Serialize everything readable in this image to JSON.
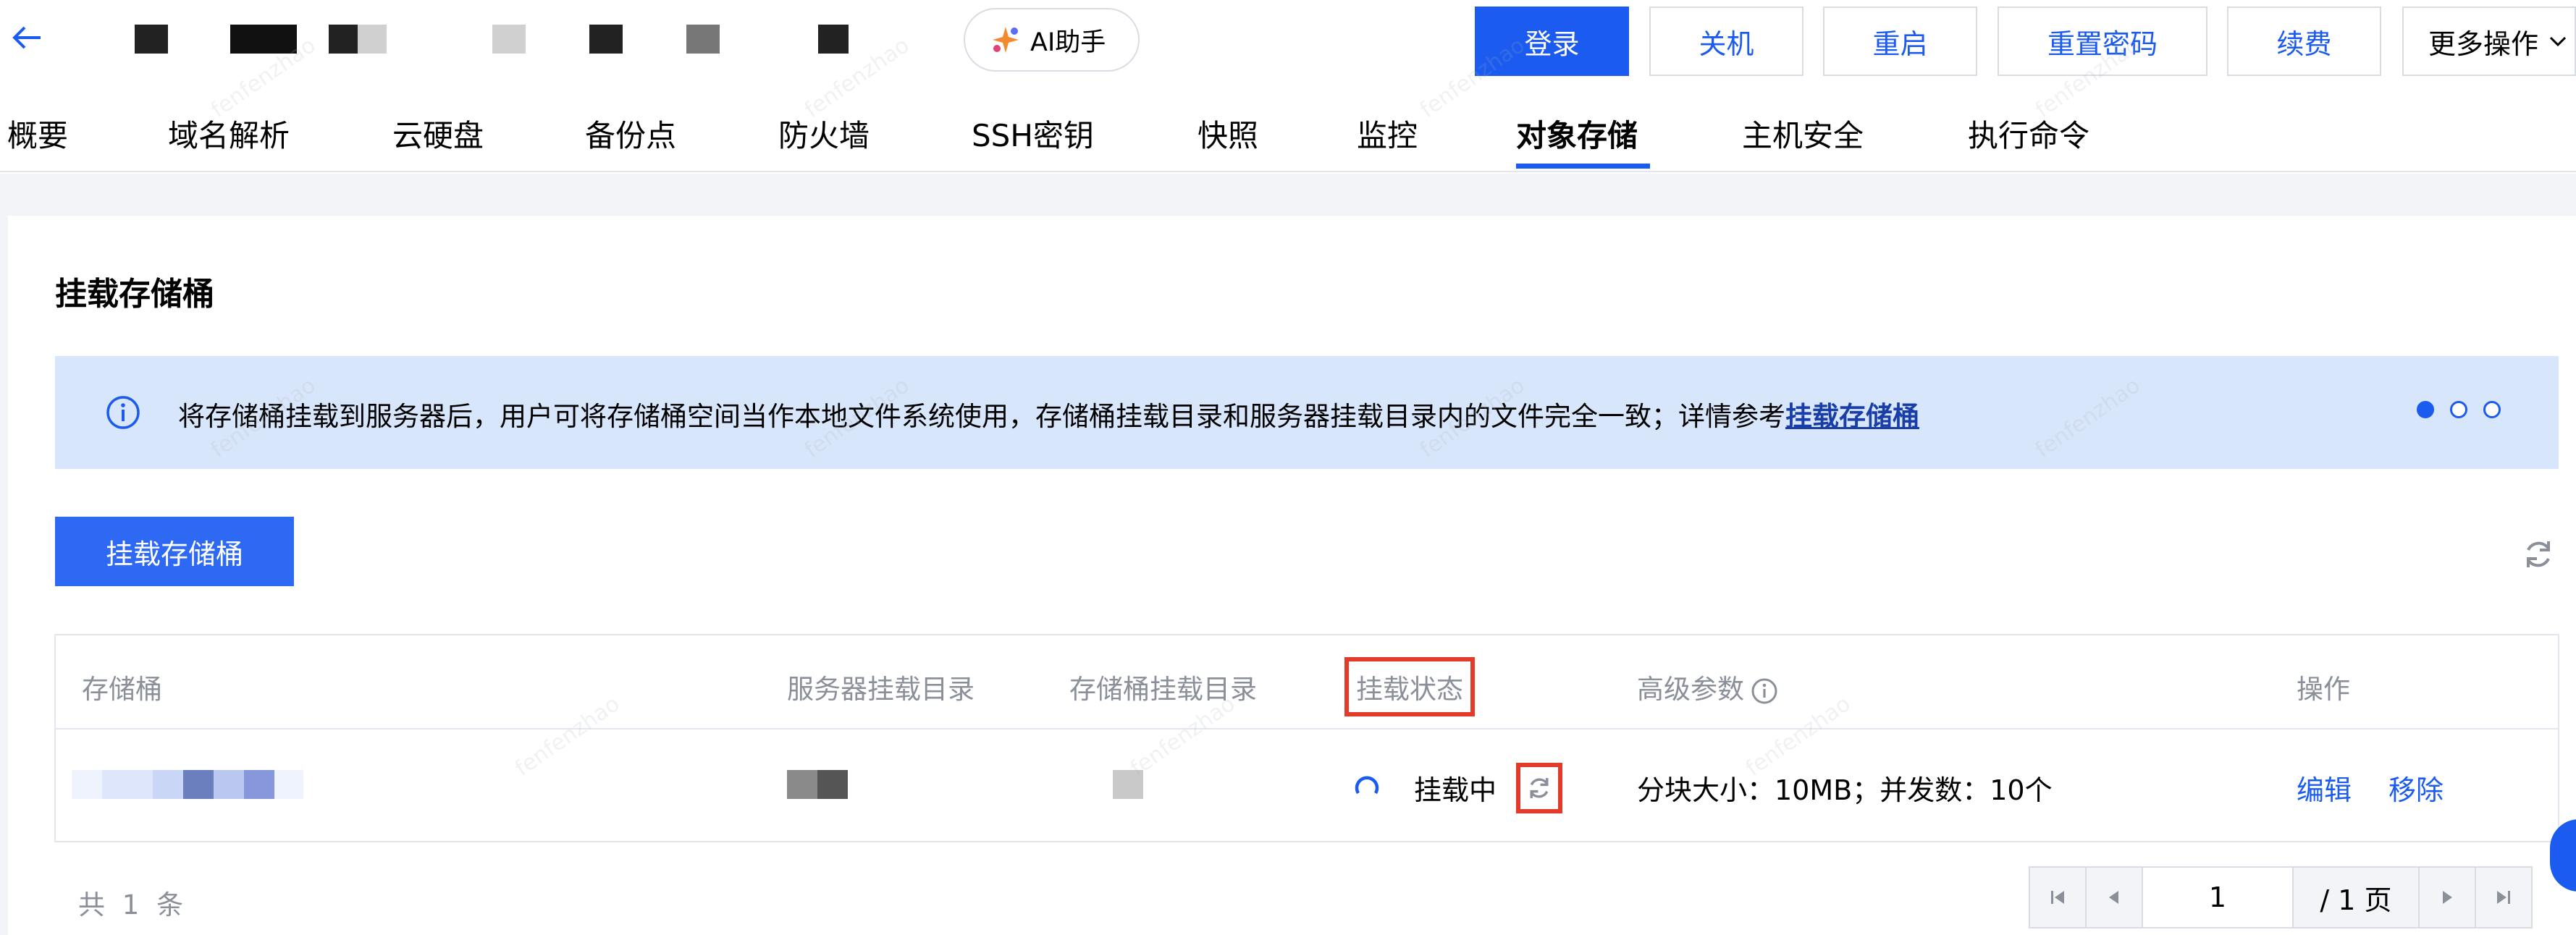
{
  "toolbar": {
    "ai_label": "AI助手",
    "login": "登录",
    "shutdown": "关机",
    "restart": "重启",
    "reset_password": "重置密码",
    "renew": "续费",
    "more": "更多操作"
  },
  "tabs": [
    "概要",
    "域名解析",
    "云硬盘",
    "备份点",
    "防火墙",
    "SSH密钥",
    "快照",
    "监控",
    "对象存储",
    "主机安全",
    "执行命令"
  ],
  "active_tab": "对象存储",
  "panel": {
    "title": "挂载存储桶",
    "notice_text": "将存储桶挂载到服务器后，用户可将存储桶空间当作本地文件系统使用，存储桶挂载目录和服务器挂载目录内的文件完全一致；详情参考",
    "notice_link": "挂载存储桶",
    "mount_button": "挂载存储桶"
  },
  "table": {
    "headers": {
      "bucket": "存储桶",
      "server_dir": "服务器挂载目录",
      "bucket_dir": "存储桶挂载目录",
      "status": "挂载状态",
      "advanced": "高级参数",
      "actions": "操作"
    },
    "row": {
      "status": "挂载中",
      "advanced": "分块大小：10MB；并发数：10个",
      "edit": "编辑",
      "remove": "移除"
    },
    "total": "共 1 条"
  },
  "pagination": {
    "current_page": "1",
    "total_pages": "/ 1 页"
  },
  "watermark_text": "fenfenzhao",
  "colors": {
    "primary": "#1b5bf0",
    "highlight": "#e23b2a",
    "notice_bg": "#d8e6fb"
  }
}
